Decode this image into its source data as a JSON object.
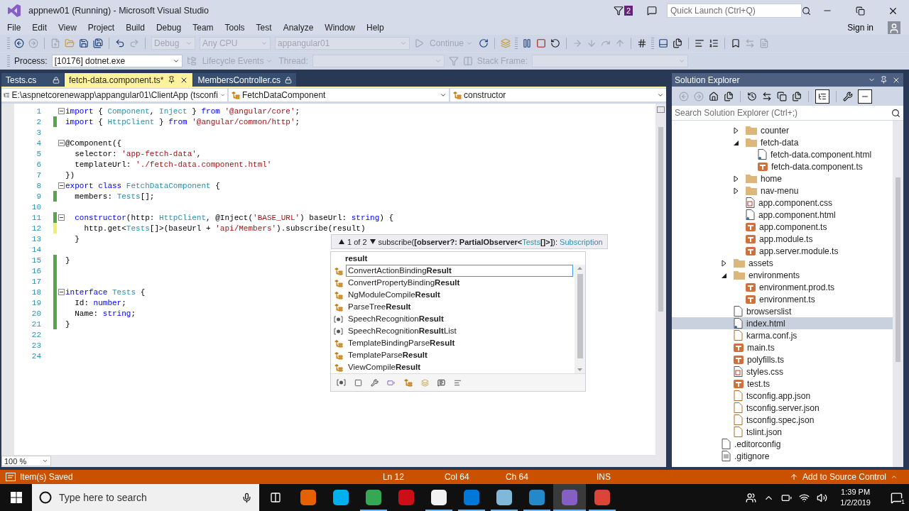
{
  "window": {
    "title": "appnew01 (Running) - Microsoft Visual Studio",
    "notification_count": "2",
    "quick_launch": {
      "placeholder": "Quick Launch (Ctrl+Q)"
    },
    "sign_in": "Sign in"
  },
  "menu": [
    "File",
    "Edit",
    "View",
    "Project",
    "Build",
    "Debug",
    "Team",
    "Tools",
    "Test",
    "Analyze",
    "Window",
    "Help"
  ],
  "toolbar": {
    "configuration": {
      "value": "Debug",
      "disabled": true
    },
    "platform": {
      "value": "Any CPU",
      "disabled": true
    },
    "startup": {
      "value": "appangular01",
      "disabled": true
    },
    "continue": {
      "label": "Continue",
      "disabled": true
    }
  },
  "debug_toolbar": {
    "process_label": "Process:",
    "process": "[10176] dotnet.exe",
    "lifecycle": {
      "label": "Lifecycle Events",
      "disabled": true
    },
    "thread_label": "Thread:",
    "stack_frame_label": "Stack Frame:"
  },
  "tabs": [
    {
      "label": "Tests.cs",
      "selected": false
    },
    {
      "label": "fetch-data.component.ts*",
      "selected": true
    },
    {
      "label": "MembersController.cs",
      "selected": false
    }
  ],
  "navigation": {
    "project": "E:\\aspnetcorenewapp\\appangular01\\ClientApp (tsconfi",
    "type": "FetchDataComponent",
    "member": "constructor"
  },
  "code": {
    "lines": [
      {
        "number": "1",
        "fold": true,
        "tokens": [
          {
            "text": "import",
            "kind": "keyword"
          },
          {
            "text": " { ",
            "kind": "plain"
          },
          {
            "text": "Component",
            "kind": "type"
          },
          {
            "text": ", ",
            "kind": "plain"
          },
          {
            "text": "Inject",
            "kind": "type"
          },
          {
            "text": " } ",
            "kind": "plain"
          },
          {
            "text": "from",
            "kind": "keyword"
          },
          {
            "text": " '@angular/core'",
            "kind": "string"
          },
          {
            "text": ";",
            "kind": "plain"
          }
        ]
      },
      {
        "number": "2",
        "saved": true,
        "tokens": [
          {
            "text": "import",
            "kind": "keyword"
          },
          {
            "text": " { ",
            "kind": "plain"
          },
          {
            "text": "HttpClient",
            "kind": "type"
          },
          {
            "text": " } ",
            "kind": "plain"
          },
          {
            "text": "from",
            "kind": "keyword"
          },
          {
            "text": " '@angular/common/http'",
            "kind": "string"
          },
          {
            "text": ";",
            "kind": "plain"
          }
        ]
      },
      {
        "number": "3"
      },
      {
        "number": "4",
        "fold": true,
        "tokens": [
          {
            "text": "@Component({",
            "kind": "plain"
          }
        ]
      },
      {
        "number": "5",
        "tokens": [
          {
            "text": "  selector: ",
            "kind": "plain"
          },
          {
            "text": "'app-fetch-data'",
            "kind": "string"
          },
          {
            "text": ",",
            "kind": "plain"
          }
        ]
      },
      {
        "number": "6",
        "tokens": [
          {
            "text": "  templateUrl: ",
            "kind": "plain"
          },
          {
            "text": "'./fetch-data.component.html'",
            "kind": "string"
          }
        ]
      },
      {
        "number": "7",
        "tokens": [
          {
            "text": "})",
            "kind": "plain"
          }
        ]
      },
      {
        "number": "8",
        "fold": true,
        "tokens": [
          {
            "text": "export class",
            "kind": "keyword"
          },
          {
            "text": " FetchDataComponent",
            "kind": "type"
          },
          {
            "text": " {",
            "kind": "plain"
          }
        ]
      },
      {
        "number": "9",
        "saved": true,
        "tokens": [
          {
            "text": "  members: ",
            "kind": "plain"
          },
          {
            "text": "Tests",
            "kind": "type"
          },
          {
            "text": "[];",
            "kind": "plain"
          }
        ]
      },
      {
        "number": "10"
      },
      {
        "number": "11",
        "saved": true,
        "fold": true,
        "tokens": [
          {
            "text": "  constructor",
            "kind": "keyword"
          },
          {
            "text": "(http: ",
            "kind": "plain"
          },
          {
            "text": "HttpClient",
            "kind": "type"
          },
          {
            "text": ", @Inject(",
            "kind": "plain"
          },
          {
            "text": "'BASE_URL'",
            "kind": "string"
          },
          {
            "text": ") baseUrl: ",
            "kind": "plain"
          },
          {
            "text": "string",
            "kind": "keyword"
          },
          {
            "text": ") {",
            "kind": "plain"
          }
        ]
      },
      {
        "number": "12",
        "saved": false,
        "tokens": [
          {
            "text": "    http.get<",
            "kind": "plain"
          },
          {
            "text": "Tests",
            "kind": "type"
          },
          {
            "text": "[]>(baseUrl + ",
            "kind": "plain"
          },
          {
            "text": "'api/Members'",
            "kind": "string"
          },
          {
            "text": ").subscribe(result)",
            "kind": "plain"
          }
        ]
      },
      {
        "number": "13",
        "tokens": [
          {
            "text": "  }",
            "kind": "plain"
          }
        ]
      },
      {
        "number": "14"
      },
      {
        "number": "15",
        "saved": true,
        "tokens": [
          {
            "text": "}",
            "kind": "plain"
          }
        ]
      },
      {
        "number": "16",
        "saved": true
      },
      {
        "number": "17",
        "saved": true
      },
      {
        "number": "18",
        "saved": true,
        "fold": true,
        "tokens": [
          {
            "text": "interface",
            "kind": "keyword"
          },
          {
            "text": " Tests",
            "kind": "type"
          },
          {
            "text": " {",
            "kind": "plain"
          }
        ]
      },
      {
        "number": "19",
        "saved": true,
        "tokens": [
          {
            "text": "  Id: ",
            "kind": "plain"
          },
          {
            "text": "number",
            "kind": "keyword"
          },
          {
            "text": ";",
            "kind": "plain"
          }
        ]
      },
      {
        "number": "20",
        "saved": true,
        "tokens": [
          {
            "text": "  Name: ",
            "kind": "plain"
          },
          {
            "text": "string",
            "kind": "keyword"
          },
          {
            "text": ";",
            "kind": "plain"
          }
        ]
      },
      {
        "number": "21",
        "saved": true,
        "tokens": [
          {
            "text": "}",
            "kind": "plain"
          }
        ]
      },
      {
        "number": "22"
      },
      {
        "number": "23"
      },
      {
        "number": "24"
      }
    ]
  },
  "signature_help": {
    "counter": "1 of 2",
    "parts": [
      {
        "text": "subscribe(",
        "kind": "plain"
      },
      {
        "text": "[observer?: PartialObserver<",
        "kind": "bold"
      },
      {
        "text": "Tests",
        "kind": "type"
      },
      {
        "text": "[]>]",
        "kind": "bold"
      },
      {
        "text": "): ",
        "kind": "plain"
      },
      {
        "text": "Subscription",
        "kind": "type"
      }
    ]
  },
  "completion": {
    "filter": "result",
    "items": [
      {
        "label": "ConvertActionBinding**Result**",
        "kind": "class",
        "selected": true
      },
      {
        "label": "ConvertPropertyBinding**Result**",
        "kind": "class",
        "selected": false
      },
      {
        "label": "NgModuleCompile**Result**",
        "kind": "class",
        "selected": false
      },
      {
        "label": "ParseTree**Result**",
        "kind": "class",
        "selected": false
      },
      {
        "label": "SpeechRecognition**Result**",
        "kind": "interface",
        "selected": false
      },
      {
        "label": "SpeechRecognition**Result**List",
        "kind": "interface",
        "selected": false
      },
      {
        "label": "TemplateBindingParse**Result**",
        "kind": "class",
        "selected": false
      },
      {
        "label": "TemplateParse**Result**",
        "kind": "class",
        "selected": false
      },
      {
        "label": "ViewCompile**Result**",
        "kind": "class",
        "selected": false
      }
    ]
  },
  "zoom": "100 %",
  "solution_explorer": {
    "title": "Solution Explorer",
    "search": {
      "placeholder": "Search Solution Explorer (Ctrl+;)"
    },
    "tree": [
      {
        "children": [
          {
            "children": [
              {
                "label": "counter",
                "kind": "folder",
                "expanded": false,
                "selected": false
              },
              {
                "label": "fetch-data",
                "kind": "folder",
                "expanded": true,
                "selected": false,
                "children": [
                  {
                    "label": "fetch-data.component.html",
                    "kind": "html",
                    "selected": false
                  },
                  {
                    "label": "fetch-data.component.ts",
                    "kind": "ts",
                    "selected": false
                  }
                ]
              },
              {
                "label": "home",
                "kind": "folder",
                "expanded": false,
                "selected": false
              },
              {
                "label": "nav-menu",
                "kind": "folder",
                "expanded": false,
                "selected": false
              },
              {
                "label": "app.component.css",
                "kind": "css",
                "selected": false
              },
              {
                "label": "app.component.html",
                "kind": "html",
                "selected": false
              },
              {
                "label": "app.component.ts",
                "kind": "ts",
                "selected": false
              },
              {
                "label": "app.module.ts",
                "kind": "ts",
                "selected": false
              },
              {
                "label": "app.server.module.ts",
                "kind": "ts",
                "selected": false
              }
            ]
          },
          {
            "label": "assets",
            "kind": "folder",
            "expanded": false,
            "selected": false
          },
          {
            "label": "environments",
            "kind": "folder",
            "expanded": true,
            "selected": false,
            "children": [
              {
                "label": "environment.prod.ts",
                "kind": "ts",
                "selected": false
              },
              {
                "label": "environment.ts",
                "kind": "ts",
                "selected": false
              }
            ]
          },
          {
            "label": "browserslist",
            "kind": "file",
            "selected": false
          },
          {
            "label": "index.html",
            "kind": "html",
            "selected": true
          },
          {
            "label": "karma.conf.js",
            "kind": "script",
            "selected": false
          },
          {
            "label": "main.ts",
            "kind": "ts",
            "selected": false
          },
          {
            "label": "polyfills.ts",
            "kind": "ts",
            "selected": false
          },
          {
            "label": "styles.css",
            "kind": "css",
            "selected": false
          },
          {
            "label": "test.ts",
            "kind": "ts",
            "selected": false
          },
          {
            "label": "tsconfig.app.json",
            "kind": "script",
            "selected": false
          },
          {
            "label": "tsconfig.server.json",
            "kind": "script",
            "selected": false
          },
          {
            "label": "tsconfig.spec.json",
            "kind": "script",
            "selected": false
          },
          {
            "label": "tslint.json",
            "kind": "script",
            "selected": false
          }
        ]
      },
      {
        "label": ".editorconfig",
        "kind": "file",
        "selected": false
      },
      {
        "label": ".gitignore",
        "kind": "text",
        "selected": false
      }
    ]
  },
  "status_bar": {
    "message": "Item(s) Saved",
    "line": "Ln 12",
    "column": "Col 64",
    "char": "Ch 64",
    "mode": "INS",
    "source_control": "Add to Source Control"
  },
  "taskbar": {
    "search": {
      "placeholder": "Type here to search"
    },
    "apps": [
      {
        "color": "#e66000",
        "running": false,
        "active": false
      },
      {
        "color": "#00aff0",
        "running": false,
        "active": false
      },
      {
        "color": "#34a853",
        "running": true,
        "active": false
      },
      {
        "color": "#cc0f16",
        "running": false,
        "active": false
      },
      {
        "color": "#f2f2f2",
        "running": true,
        "active": false
      },
      {
        "color": "#0078d7",
        "running": true,
        "active": false
      },
      {
        "color": "#7fb8d8",
        "running": true,
        "active": false
      },
      {
        "color": "#2489ca",
        "running": true,
        "active": false
      },
      {
        "color": "#865fc5",
        "running": true,
        "active": true
      },
      {
        "color": "#db4437",
        "running": true,
        "active": false
      }
    ],
    "time": "1:39 PM",
    "date": "1/2/2019",
    "notifications": "1"
  }
}
